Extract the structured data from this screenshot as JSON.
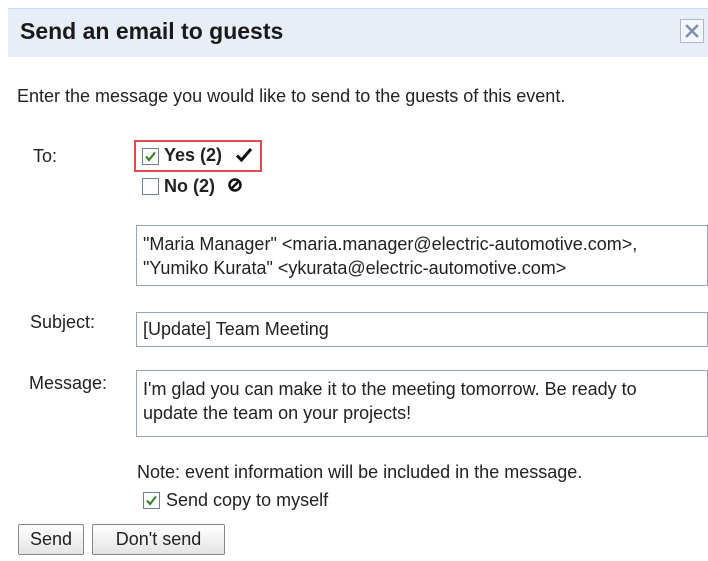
{
  "dialog": {
    "title": "Send an email to guests",
    "intro": "Enter the message you would like to send to the guests of this event."
  },
  "to": {
    "label": "To:",
    "yes_label": "Yes (2)",
    "yes_checked": true,
    "no_label": "No (2)",
    "no_checked": false,
    "recipients": [
      "\"Maria Manager\" <maria.manager@electric-automotive.com>,",
      "\"Yumiko Kurata\" <ykurata@electric-automotive.com>"
    ]
  },
  "subject": {
    "label": "Subject:",
    "value": "[Update] Team Meeting"
  },
  "message": {
    "label": "Message:",
    "lines": [
      "I'm glad you can make it to the meeting tomorrow. Be ready to",
      "update the team on your projects!"
    ]
  },
  "note": "Note: event information will be included in the message.",
  "copy": {
    "label": "Send copy to myself",
    "checked": true
  },
  "buttons": {
    "send": "Send",
    "dont_send": "Don't send"
  },
  "icons": {
    "close": "close-icon",
    "yes_status": "checkmark-icon",
    "no_status": "declined-icon"
  },
  "colors": {
    "titlebar_bg": "#e8eef7",
    "highlight": "#e04a4a",
    "checkmark": "#2f7d1f"
  }
}
